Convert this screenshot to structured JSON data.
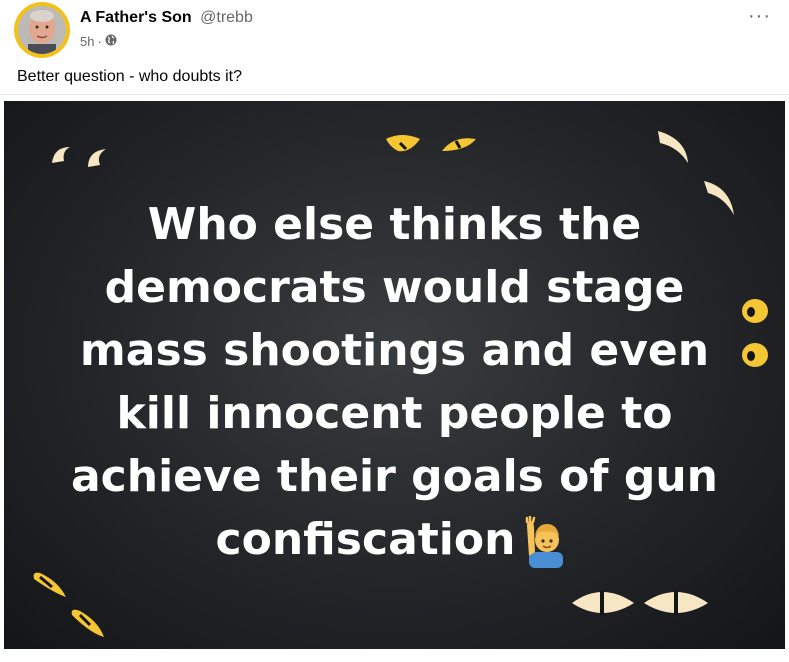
{
  "post": {
    "author": "A Father's Son",
    "handle": "@trebb",
    "time": "5h",
    "separator": "·",
    "audience_icon": "globe-icon",
    "more_label": "···",
    "caption": "Better question - who doubts it?"
  },
  "image": {
    "lines": [
      "Who else thinks the",
      "democrats would stage",
      "mass shootings and even",
      "kill innocent people to",
      "achieve their goals of gun",
      "confiscation"
    ],
    "emoji": "person-raising-hand-emoji"
  },
  "colors": {
    "avatar_ring": "#f2c21b",
    "image_bg": "#232528",
    "eye_yellow": "#f4c634",
    "eye_cream": "#f7e6c4"
  }
}
